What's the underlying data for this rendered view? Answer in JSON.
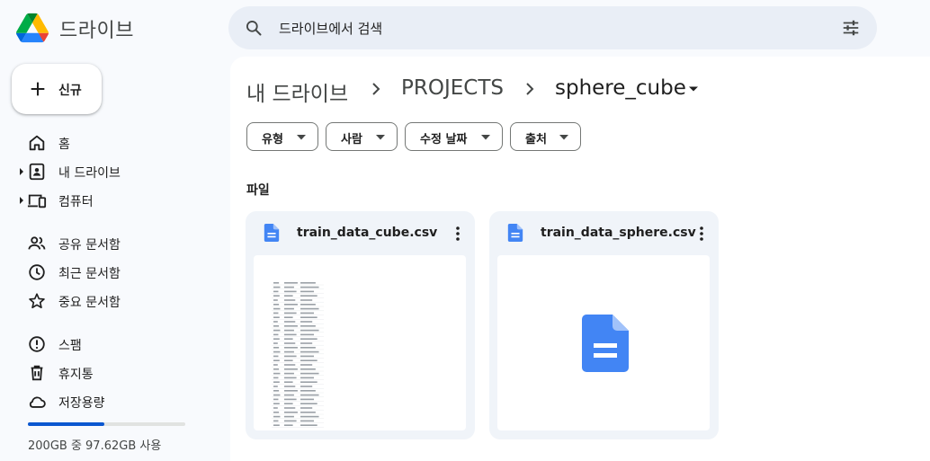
{
  "app": {
    "name": "드라이브"
  },
  "search": {
    "placeholder": "드라이브에서 검색"
  },
  "new_button": {
    "label": "신규"
  },
  "sidebar": {
    "items": [
      {
        "label": "홈",
        "icon": "home-icon"
      },
      {
        "label": "내 드라이브",
        "icon": "my-drive-icon"
      },
      {
        "label": "컴퓨터",
        "icon": "computer-icon"
      },
      {
        "label": "공유 문서함",
        "icon": "shared-icon"
      },
      {
        "label": "최근 문서함",
        "icon": "clock-icon"
      },
      {
        "label": "중요 문서함",
        "icon": "star-icon"
      },
      {
        "label": "스팸",
        "icon": "spam-icon"
      },
      {
        "label": "휴지통",
        "icon": "trash-icon"
      },
      {
        "label": "저장용량",
        "icon": "cloud-icon"
      }
    ]
  },
  "storage": {
    "text": "200GB 중 97.62GB 사용",
    "used_fraction": 0.488
  },
  "breadcrumb": {
    "root": "내 드라이브",
    "parent": "PROJECTS",
    "current": "sphere_cube"
  },
  "filters": [
    "유형",
    "사람",
    "수정 날짜",
    "출처"
  ],
  "section": {
    "title": "파일"
  },
  "files": [
    {
      "name": "train_data_cube.csv",
      "icon": "doc-icon"
    },
    {
      "name": "train_data_sphere.csv",
      "icon": "doc-icon"
    }
  ],
  "colors": {
    "accent": "#0b57d0",
    "doc_blue": "#4285f4"
  }
}
